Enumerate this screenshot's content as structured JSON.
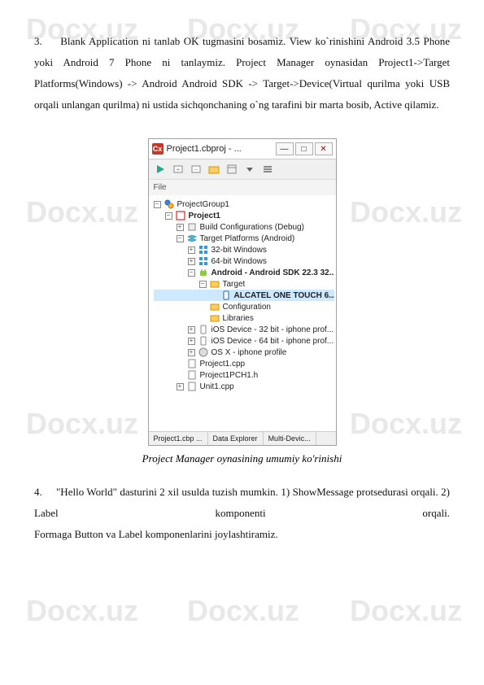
{
  "watermark": "Docx.uz",
  "para3_num": "3.",
  "para3_text": "Blank Application ni tanlab OK tugmasini bosamiz. View ko`rinishini Android 3.5 Phone yoki Android 7 Phone ni tanlaymiz. Project Manager oynasidan Project1->Target Platforms(Windows) -> Android Android SDK -> Target->Device(Virtual qurilma yoki USB orqali unlangan qurilma) ni ustida sichqonchaning o`ng tarafini bir marta bosib, Active qilamiz.",
  "window": {
    "title": "Project1.cbproj - ...",
    "min": "—",
    "max": "□",
    "close": "✕"
  },
  "section": "File",
  "tree": {
    "root": "ProjectGroup1",
    "project": "Project1",
    "build": "Build Configurations (Debug)",
    "target_platforms": "Target Platforms (Android)",
    "win32": "32-bit Windows",
    "win64": "64-bit Windows",
    "android": "Android - Android SDK 22.3 32...",
    "target": "Target",
    "device": "ALCATEL ONE TOUCH 6...",
    "config": "Configuration",
    "libs": "Libraries",
    "ios32": "iOS Device - 32 bit - iphone prof...",
    "ios64": "iOS Device - 64 bit - iphone prof...",
    "osx": "OS X - iphone profile",
    "cpp": "Project1.cpp",
    "pch": "Project1PCH1.h",
    "unit": "Unit1.cpp"
  },
  "tabs": {
    "t1": "Project1.cbp ...",
    "t2": "Data Explorer",
    "t3": "Multi-Devic..."
  },
  "caption": "Project Manager oynasining umumiy ko'rinishi",
  "para4_num": "4.",
  "para4_text": "\"Hello World\" dasturini 2 xil usulda tuzish mumkin. 1) ShowMessage protsedurasi orqali. 2) Label komponenti orqali.",
  "para4_line2": "Formaga Button va Label komponenlarini joylashtiramiz."
}
